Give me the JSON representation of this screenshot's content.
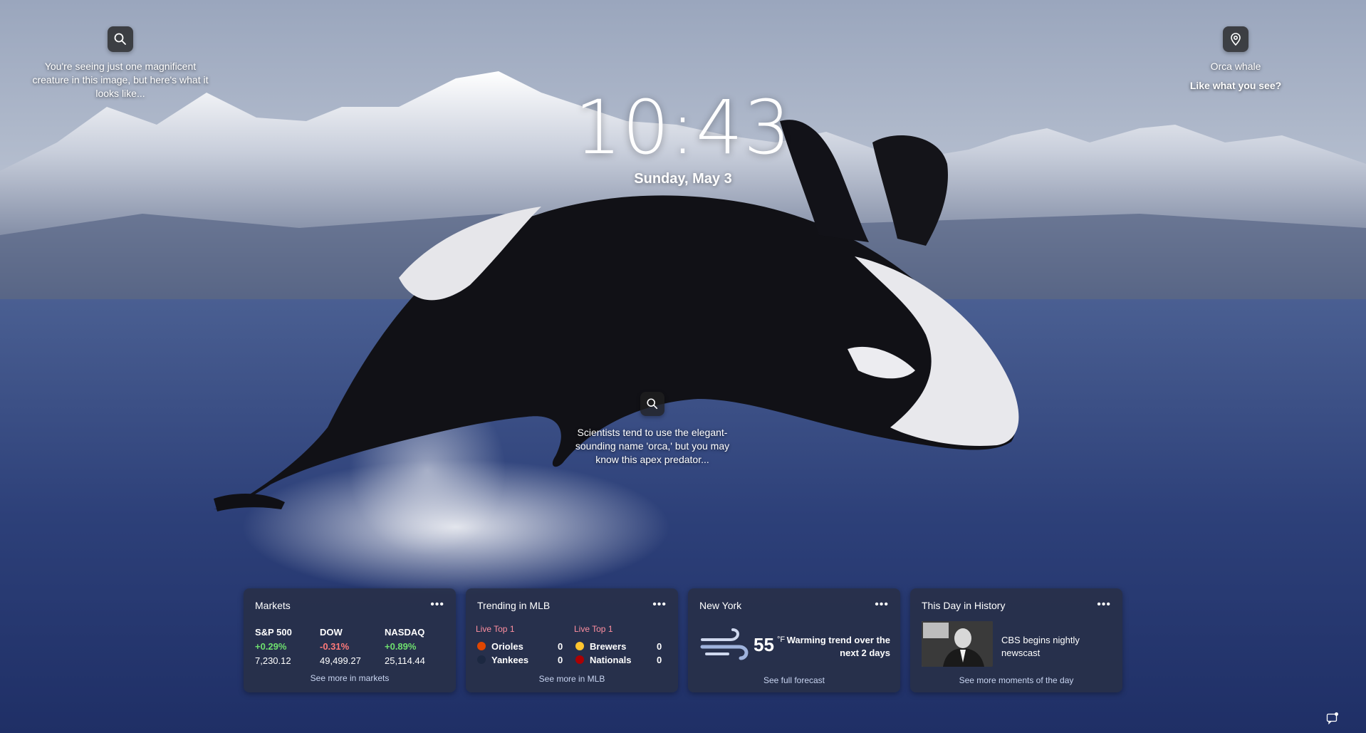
{
  "clock": {
    "time": "10:43",
    "date": "Sunday, May 3"
  },
  "top_left": {
    "caption_line1": "You're seeing just one magnificent",
    "caption_line2": "creature in this image, but here's what it",
    "caption_line3": "looks like..."
  },
  "top_right": {
    "location": "Orca whale",
    "prompt": "Like what you see?"
  },
  "center_hotspot": {
    "caption_line1": "Scientists tend to use the elegant-",
    "caption_line2": "sounding name 'orca,' but you may",
    "caption_line3": "know this apex predator..."
  },
  "widgets": {
    "markets": {
      "title": "Markets",
      "more": "•••",
      "stocks": [
        {
          "name": "S&P 500",
          "change": "+0.29%",
          "value": "7,230.12",
          "direction": "up"
        },
        {
          "name": "DOW",
          "change": "-0.31%",
          "value": "49,499.27",
          "direction": "down"
        },
        {
          "name": "NASDAQ",
          "change": "+0.89%",
          "value": "25,114.44",
          "direction": "up"
        }
      ],
      "link": "See more in markets"
    },
    "mlb": {
      "title": "Trending in MLB",
      "more": "•••",
      "games": [
        {
          "status": "Live Top 1",
          "team1": "Orioles",
          "score1": "0",
          "team2": "Yankees",
          "score2": "0"
        },
        {
          "status": "Live Top 1",
          "team1": "Brewers",
          "score1": "0",
          "team2": "Nationals",
          "score2": "0"
        }
      ],
      "link": "See more in MLB"
    },
    "weather": {
      "title": "New York",
      "more": "•••",
      "temp": "55",
      "unit": "°F",
      "forecast": "Warming trend over the next 2 days",
      "link": "See full forecast"
    },
    "history": {
      "title": "This Day in History",
      "more": "•••",
      "headline": "CBS begins nightly newscast",
      "link": "See more moments of the day"
    }
  },
  "colors": {
    "up": "#6ee06e",
    "down": "#ff7a7a",
    "live": "#ff8fa0",
    "widget_bg": "#283048"
  },
  "icons": {
    "search": "search-icon",
    "location": "location-pin-icon",
    "wind": "wind-icon",
    "notification": "notification-icon"
  }
}
